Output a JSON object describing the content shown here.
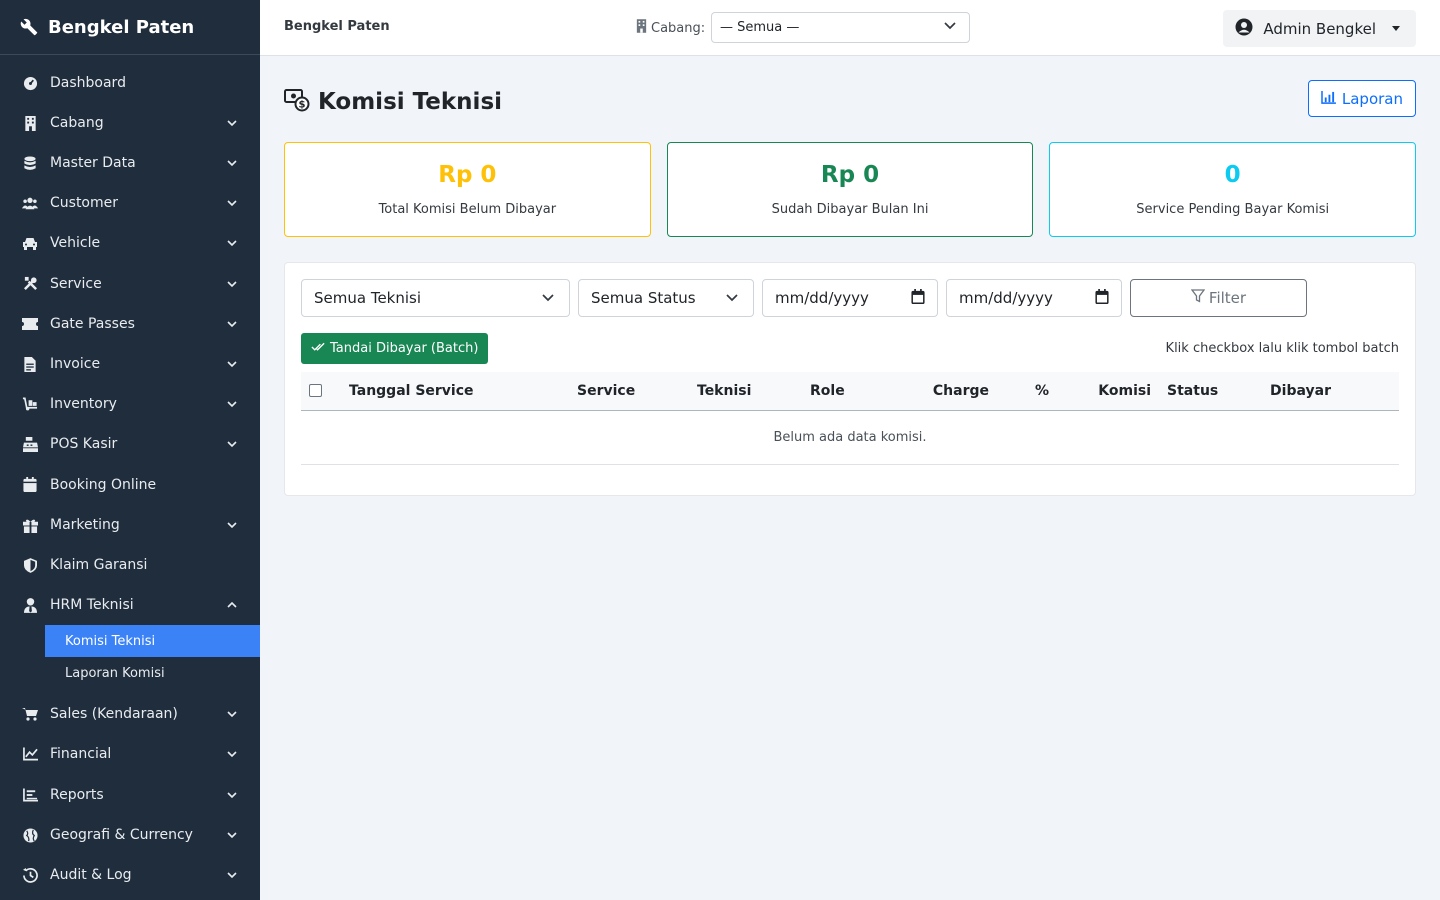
{
  "sidebar": {
    "brand": "Bengkel Paten",
    "items": [
      {
        "label": "Dashboard",
        "icon": "gauge-icon",
        "expandable": false
      },
      {
        "label": "Cabang",
        "icon": "building-icon",
        "expandable": true
      },
      {
        "label": "Master Data",
        "icon": "database-icon",
        "expandable": true
      },
      {
        "label": "Customer",
        "icon": "users-icon",
        "expandable": true
      },
      {
        "label": "Vehicle",
        "icon": "car-icon",
        "expandable": true
      },
      {
        "label": "Service",
        "icon": "tools-icon",
        "expandable": true
      },
      {
        "label": "Gate Passes",
        "icon": "ticket-icon",
        "expandable": true
      },
      {
        "label": "Invoice",
        "icon": "invoice-icon",
        "expandable": true
      },
      {
        "label": "Inventory",
        "icon": "dolly-icon",
        "expandable": true
      },
      {
        "label": "POS Kasir",
        "icon": "cash-register-icon",
        "expandable": true
      },
      {
        "label": "Booking Online",
        "icon": "calendar-icon",
        "expandable": false
      },
      {
        "label": "Marketing",
        "icon": "gift-icon",
        "expandable": true
      },
      {
        "label": "Klaim Garansi",
        "icon": "shield-icon",
        "expandable": false
      },
      {
        "label": "HRM Teknisi",
        "icon": "user-tie-icon",
        "expandable": true,
        "open": true
      }
    ],
    "subitems": [
      {
        "label": "Komisi Teknisi",
        "active": true
      },
      {
        "label": "Laporan Komisi",
        "active": false
      }
    ],
    "items_after": [
      {
        "label": "Sales (Kendaraan)",
        "icon": "cart-icon"
      },
      {
        "label": "Financial",
        "icon": "chart-line-icon"
      },
      {
        "label": "Reports",
        "icon": "reports-icon"
      },
      {
        "label": "Geografi & Currency",
        "icon": "globe-icon"
      },
      {
        "label": "Audit & Log",
        "icon": "history-icon"
      }
    ]
  },
  "topbar": {
    "brand": "Bengkel Paten",
    "branch_label": "Cabang:",
    "branch_value": "— Semua —",
    "user": "Admin Bengkel"
  },
  "page": {
    "title": "Komisi Teknisi",
    "report_button": "Laporan"
  },
  "cards": [
    {
      "value": "Rp 0",
      "caption": "Total Komisi Belum Dibayar",
      "tone": "warn"
    },
    {
      "value": "Rp 0",
      "caption": "Sudah Dibayar Bulan Ini",
      "tone": "succ"
    },
    {
      "value": "0",
      "caption": "Service Pending Bayar Komisi",
      "tone": "info"
    }
  ],
  "filters": {
    "technician": "Semua Teknisi",
    "status": "Semua Status",
    "date_from": "mm/dd/yyyy",
    "date_to": "mm/dd/yyyy",
    "filter_button": "Filter"
  },
  "batch": {
    "button": "Tandai Dibayar (Batch)",
    "hint": "Klik checkbox lalu klik tombol batch"
  },
  "table": {
    "headers": [
      "Tanggal Service",
      "Service",
      "Teknisi",
      "Role",
      "Charge",
      "%",
      "Komisi",
      "Status",
      "Dibayar"
    ],
    "empty": "Belum ada data komisi."
  },
  "colors": {
    "sidebar_bg": "#1f2d3d",
    "active": "#3b82f6",
    "warning": "#ffc107",
    "success": "#198754",
    "info": "#0dcaf0",
    "primary": "#0d6efd"
  }
}
